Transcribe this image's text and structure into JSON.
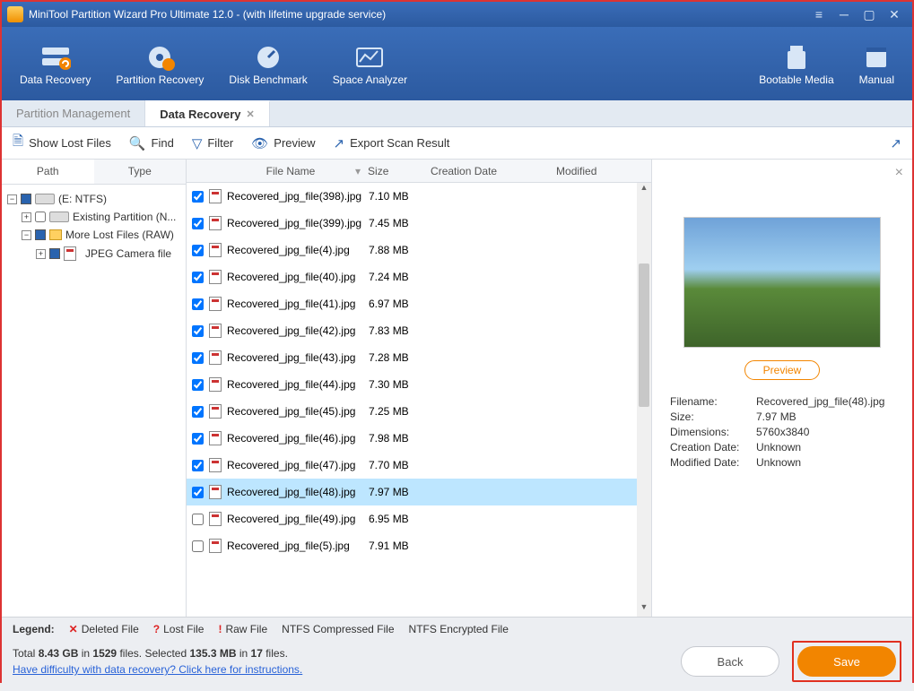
{
  "titlebar": {
    "title": "MiniTool Partition Wizard Pro Ultimate 12.0 - (with lifetime upgrade service)"
  },
  "ribbon": {
    "items": [
      {
        "label": "Data Recovery"
      },
      {
        "label": "Partition Recovery"
      },
      {
        "label": "Disk Benchmark"
      },
      {
        "label": "Space Analyzer"
      }
    ],
    "right": [
      {
        "label": "Bootable Media"
      },
      {
        "label": "Manual"
      }
    ]
  },
  "maintabs": {
    "items": [
      {
        "label": "Partition Management"
      },
      {
        "label": "Data Recovery"
      }
    ],
    "active": 1
  },
  "toolbar": {
    "showlost": "Show Lost Files",
    "find": "Find",
    "filter": "Filter",
    "preview": "Preview",
    "export": "Export Scan Result"
  },
  "subtabs": {
    "items": [
      "Path",
      "Type"
    ],
    "active": 0
  },
  "tree": {
    "root": "(E: NTFS)",
    "nodes": [
      {
        "label": "Existing Partition (N...",
        "checked": false
      },
      {
        "label": "More Lost Files (RAW)",
        "checked": true
      },
      {
        "label": "JPEG Camera file",
        "checked": true,
        "indent": 2
      }
    ]
  },
  "columns": {
    "fn": "File Name",
    "sz": "Size",
    "cd": "Creation Date",
    "md": "Modified"
  },
  "files": [
    {
      "name": "Recovered_jpg_file(398).jpg",
      "size": "7.10 MB",
      "checked": true
    },
    {
      "name": "Recovered_jpg_file(399).jpg",
      "size": "7.45 MB",
      "checked": true
    },
    {
      "name": "Recovered_jpg_file(4).jpg",
      "size": "7.88 MB",
      "checked": true
    },
    {
      "name": "Recovered_jpg_file(40).jpg",
      "size": "7.24 MB",
      "checked": true
    },
    {
      "name": "Recovered_jpg_file(41).jpg",
      "size": "6.97 MB",
      "checked": true
    },
    {
      "name": "Recovered_jpg_file(42).jpg",
      "size": "7.83 MB",
      "checked": true
    },
    {
      "name": "Recovered_jpg_file(43).jpg",
      "size": "7.28 MB",
      "checked": true
    },
    {
      "name": "Recovered_jpg_file(44).jpg",
      "size": "7.30 MB",
      "checked": true
    },
    {
      "name": "Recovered_jpg_file(45).jpg",
      "size": "7.25 MB",
      "checked": true
    },
    {
      "name": "Recovered_jpg_file(46).jpg",
      "size": "7.98 MB",
      "checked": true
    },
    {
      "name": "Recovered_jpg_file(47).jpg",
      "size": "7.70 MB",
      "checked": true
    },
    {
      "name": "Recovered_jpg_file(48).jpg",
      "size": "7.97 MB",
      "checked": true,
      "selected": true
    },
    {
      "name": "Recovered_jpg_file(49).jpg",
      "size": "6.95 MB",
      "checked": false
    },
    {
      "name": "Recovered_jpg_file(5).jpg",
      "size": "7.91 MB",
      "checked": false
    }
  ],
  "preview": {
    "button": "Preview",
    "labels": {
      "fn": "Filename:",
      "sz": "Size:",
      "dim": "Dimensions:",
      "cd": "Creation Date:",
      "md": "Modified Date:"
    },
    "values": {
      "fn": "Recovered_jpg_file(48).jpg",
      "sz": "7.97 MB",
      "dim": "5760x3840",
      "cd": "Unknown",
      "md": "Unknown"
    }
  },
  "legend": {
    "title": "Legend:",
    "items": [
      "Deleted File",
      "Lost File",
      "Raw File",
      "NTFS Compressed File",
      "NTFS Encrypted File"
    ]
  },
  "stats": {
    "total_pre": "Total ",
    "total_size": "8.43 GB",
    "total_mid": " in ",
    "total_files": "1529",
    "total_post": " files.  Selected ",
    "sel_size": "135.3 MB",
    "sel_mid": " in ",
    "sel_files": "17",
    "sel_post": " files."
  },
  "helplink": "Have difficulty with data recovery? Click here for instructions.",
  "buttons": {
    "back": "Back",
    "save": "Save"
  }
}
